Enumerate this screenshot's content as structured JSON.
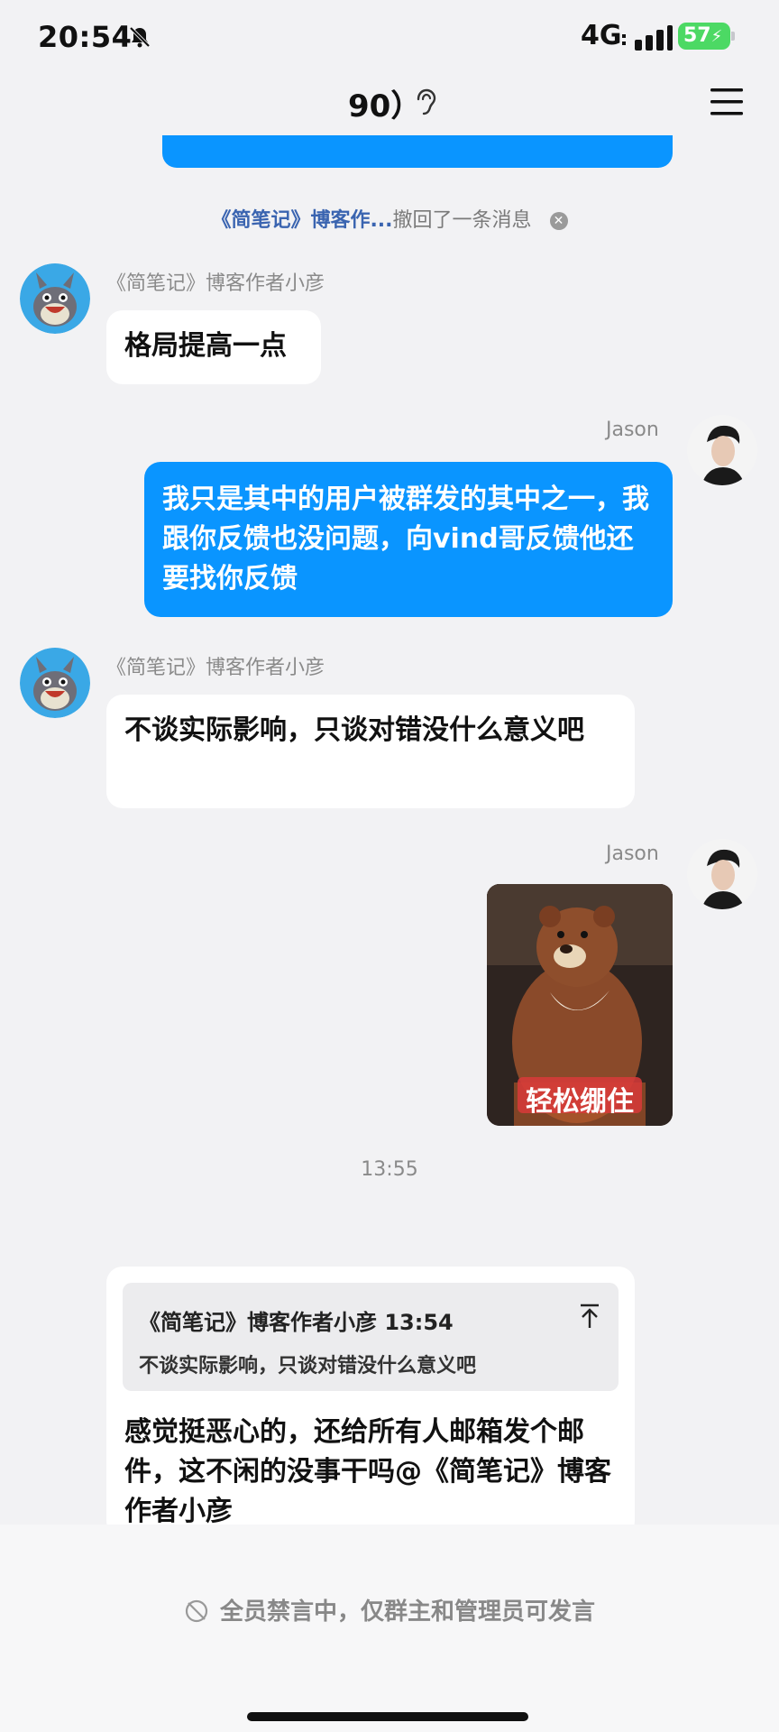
{
  "status_bar": {
    "time": "20:54",
    "network": "4G",
    "battery": "57"
  },
  "nav": {
    "title": "90）"
  },
  "recall_notice": {
    "name": "《简笔记》博客作...",
    "text": "撤回了一条消息"
  },
  "messages": [
    {
      "sender": "《简笔记》博客作者小彦",
      "text": "格局提高一点"
    },
    {
      "sender": "Jason",
      "text": "我只是其中的用户被群发的其中之一，我跟你反馈也没问题，向vind哥反馈他还要找你反馈"
    },
    {
      "sender": "《简笔记》博客作者小彦",
      "text": "不谈实际影响，只谈对错没什么意义吧"
    },
    {
      "sender": "Jason",
      "sticker_caption": "轻松绷住"
    }
  ],
  "time_separator": "13:55",
  "reply": {
    "quote_header": "《简笔记》博客作者小彦 13:54",
    "quote_text": "不谈实际影响，只谈对错没什么意义吧",
    "text": "感觉挺恶心的，还给所有人邮箱发个邮件，这不闲的没事干吗@《简笔记》博客作者小彦"
  },
  "footer": {
    "mute_text": "全员禁言中，仅群主和管理员可发言"
  }
}
